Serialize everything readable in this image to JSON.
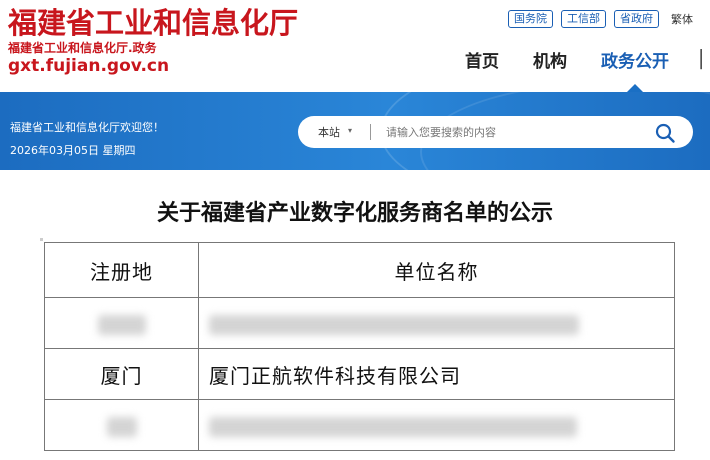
{
  "header": {
    "logo_title": "福建省工业和信息化厅",
    "logo_sub": "福建省工业和信息化厅.政务",
    "logo_url": "gxt.fujian.gov.cn",
    "top_links": [
      "国务院",
      "工信部",
      "省政府"
    ],
    "lang_switch": "繁体",
    "nav": [
      "首页",
      "机构",
      "政务公开"
    ]
  },
  "bluebar": {
    "welcome": "福建省工业和信息化厅欢迎您！",
    "date": "2026年03月05日 星期四"
  },
  "search": {
    "scope": "本站",
    "placeholder": "请输入您要搜索的内容"
  },
  "page": {
    "title": "关于福建省产业数字化服务商名单的公示"
  },
  "table": {
    "headers": [
      "注册地",
      "单位名称"
    ],
    "rows": [
      {
        "location": "",
        "name": ""
      },
      {
        "location": "厦门",
        "name": "厦门正航软件科技有限公司"
      },
      {
        "location": "",
        "name": ""
      }
    ]
  },
  "colors": {
    "brand_red": "#c8161d",
    "brand_blue": "#1a5fb4"
  }
}
